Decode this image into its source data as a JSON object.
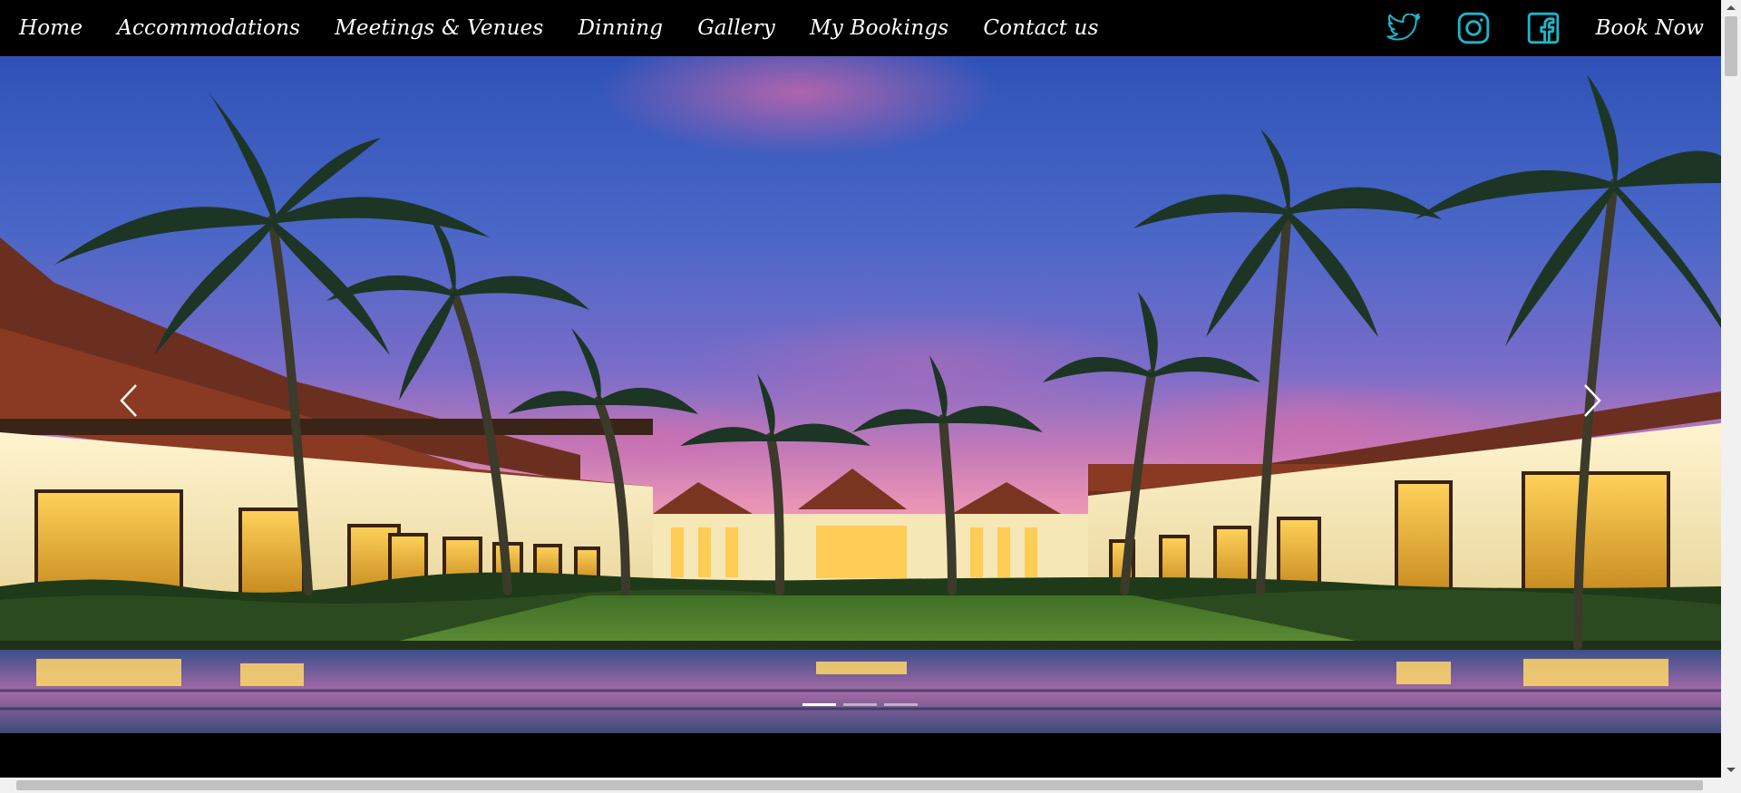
{
  "nav": {
    "items": [
      {
        "label": "Home"
      },
      {
        "label": "Accommodations"
      },
      {
        "label": "Meetings & Venues"
      },
      {
        "label": "Dinning"
      },
      {
        "label": "Gallery"
      },
      {
        "label": "My Bookings"
      },
      {
        "label": "Contact us"
      }
    ],
    "social": [
      "twitter-icon",
      "instagram-icon",
      "facebook-icon"
    ],
    "book_now": "Book Now"
  },
  "hero": {
    "image": "resort-courtyard-palms-dusk-image",
    "slides": 3,
    "active_slide": 1
  },
  "colors": {
    "nav_bg": "#000000",
    "nav_text": "#ffffff",
    "social_accent": "#1fb5c9"
  }
}
